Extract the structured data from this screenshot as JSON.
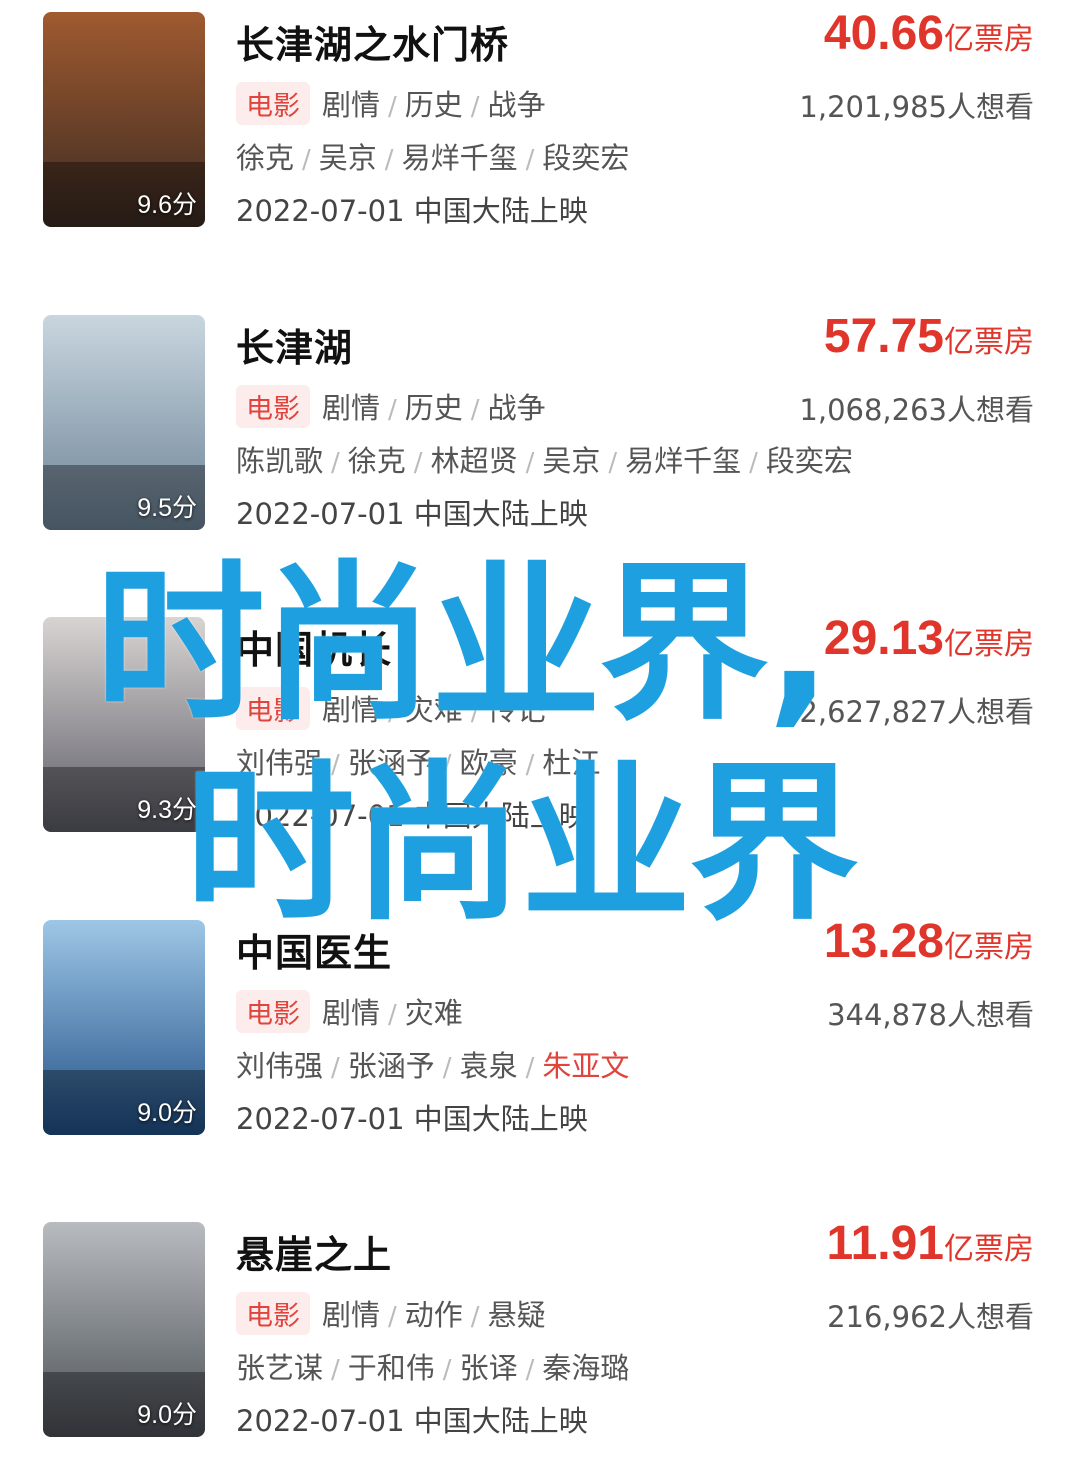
{
  "movies": [
    {
      "title": "长津湖之水门桥",
      "score": "9.6分",
      "tag": "电影",
      "genres": [
        "剧情",
        "历史",
        "战争"
      ],
      "cast": [
        "徐克",
        "吴京",
        "易烊千玺",
        "段奕宏"
      ],
      "release": "2022-07-01 中国大陆上映",
      "box_value": "40.66",
      "box_unit": "亿票房",
      "want": "1,201,985人想看",
      "poster_colors": [
        "#3a2a22",
        "#a05a30"
      ]
    },
    {
      "title": "长津湖",
      "score": "9.5分",
      "tag": "电影",
      "genres": [
        "剧情",
        "历史",
        "战争"
      ],
      "cast": [
        "陈凯歌",
        "徐克",
        "林超贤",
        "吴京",
        "易烊千玺",
        "段奕宏"
      ],
      "release": "2022-07-01 中国大陆上映",
      "box_value": "57.75",
      "box_unit": "亿票房",
      "want": "1,068,263人想看",
      "poster_colors": [
        "#6b8296",
        "#c9d6df"
      ]
    },
    {
      "title": "中国机长",
      "score": "9.3分",
      "tag": "电影",
      "genres": [
        "剧情",
        "灾难",
        "传记"
      ],
      "cast": [
        "刘伟强",
        "张涵予",
        "欧豪",
        "杜江"
      ],
      "release": "2022-07-01 中国大陆上映",
      "box_value": "29.13",
      "box_unit": "亿票房",
      "want": "2,627,827人想看",
      "poster_colors": [
        "#5b5b66",
        "#d8d4d2"
      ]
    },
    {
      "title": "中国医生",
      "score": "9.0分",
      "tag": "电影",
      "genres": [
        "剧情",
        "灾难"
      ],
      "cast": [
        "刘伟强",
        "张涵予",
        "袁泉",
        "朱亚文"
      ],
      "highlight_cast": "朱亚文",
      "release": "2022-07-01 中国大陆上映",
      "box_value": "13.28",
      "box_unit": "亿票房",
      "want": "344,878人想看",
      "poster_colors": [
        "#1f4f86",
        "#9ec6e6"
      ]
    },
    {
      "title": "悬崖之上",
      "score": "9.0分",
      "tag": "电影",
      "genres": [
        "剧情",
        "动作",
        "悬疑"
      ],
      "cast": [
        "张艺谋",
        "于和伟",
        "张译",
        "秦海璐"
      ],
      "release": "2022-07-01 中国大陆上映",
      "box_value": "11.91",
      "box_unit": "亿票房",
      "want": "216,962人想看",
      "poster_colors": [
        "#4a4f55",
        "#b8bcc0"
      ]
    }
  ],
  "watermark": {
    "line1": "时尚业界,",
    "line2": "时尚业界"
  },
  "colors": {
    "accent_red": "#e0352b",
    "tag_bg": "#fdecec",
    "watermark_blue": "#1ea0e0"
  }
}
